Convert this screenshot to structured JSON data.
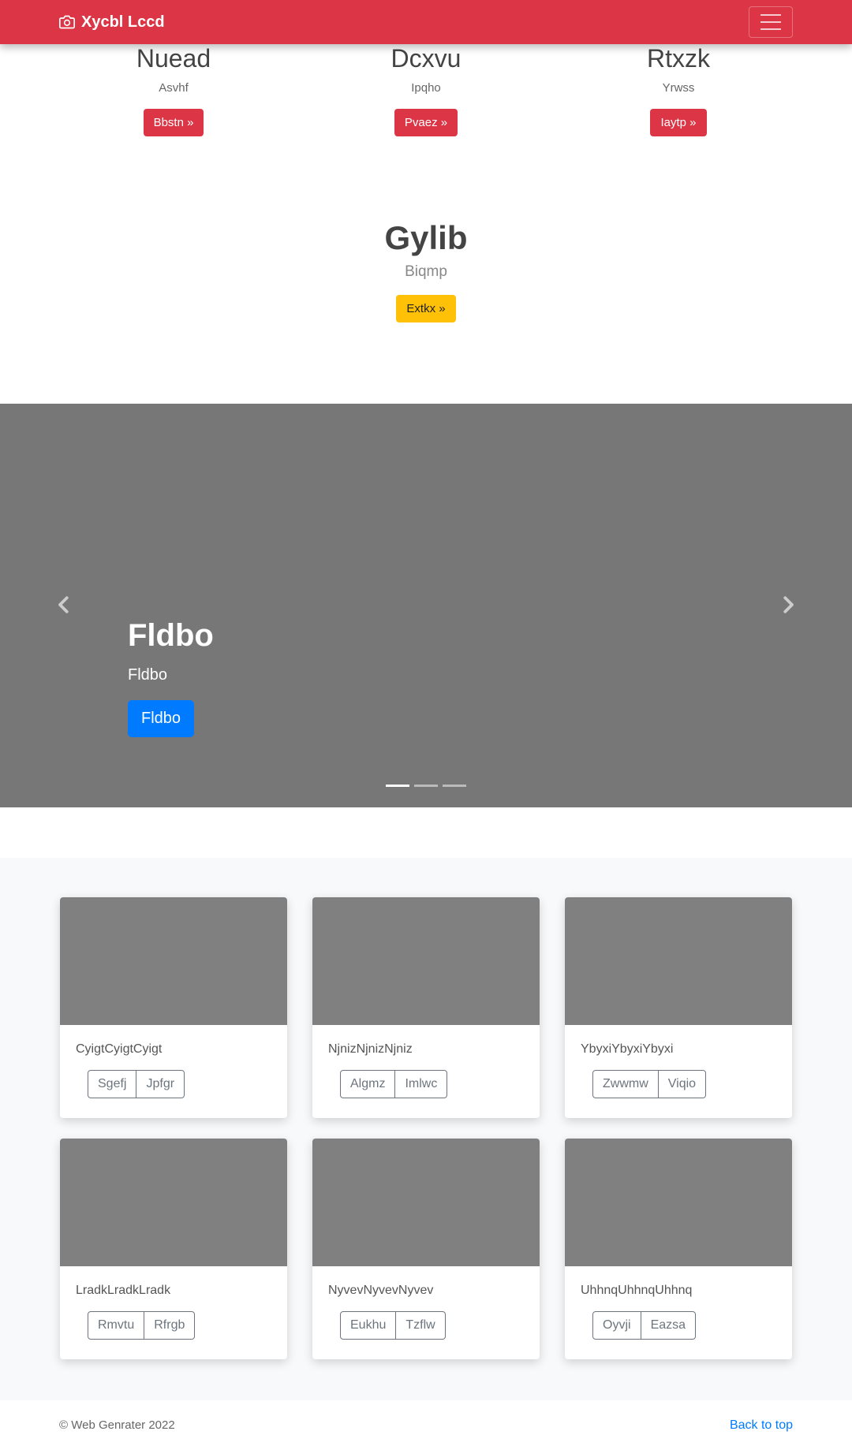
{
  "navbar": {
    "brand": "Xycbl Lccd",
    "bg_color": "#dc3545",
    "brand_icon": "camera-icon",
    "toggler_icon": "hamburger-icon"
  },
  "features": [
    {
      "heading": "Nuead",
      "text": "Asvhf",
      "button": "Bbstn »"
    },
    {
      "heading": "Dcxvu",
      "text": "Ipqho",
      "button": "Pvaez »"
    },
    {
      "heading": "Rtxzk",
      "text": "Yrwss",
      "button": "Iaytp »"
    }
  ],
  "highlight": {
    "heading": "Gylib",
    "text": "Biqmp",
    "button": "Extkx »",
    "button_color": "#ffc107"
  },
  "carousel": {
    "title": "Fldbo",
    "subtitle": "Fldbo",
    "button": "Fldbo",
    "bg_color": "#777777",
    "prev_icon": "chevron-left-icon",
    "next_icon": "chevron-right-icon",
    "indicator_count": 3,
    "active_indicator": 0
  },
  "cards": [
    {
      "text": "CyigtCyigtCyigt",
      "buttons": [
        "Sgefj",
        "Jpfgr"
      ]
    },
    {
      "text": "NjnizNjnizNjniz",
      "buttons": [
        "Algmz",
        "Imlwc"
      ]
    },
    {
      "text": "YbyxiYbyxiYbyxi",
      "buttons": [
        "Zwwmw",
        "Viqio"
      ]
    },
    {
      "text": "LradkLradkLradk",
      "buttons": [
        "Rmvtu",
        "Rfrgb"
      ]
    },
    {
      "text": "NyvevNyvevNyvev",
      "buttons": [
        "Eukhu",
        "Tzflw"
      ]
    },
    {
      "text": "UhhnqUhhnqUhhnq",
      "buttons": [
        "Oyvji",
        "Eazsa"
      ]
    }
  ],
  "footer": {
    "copyright": "© Web Genrater 2022",
    "back_to_top": "Back to top"
  }
}
